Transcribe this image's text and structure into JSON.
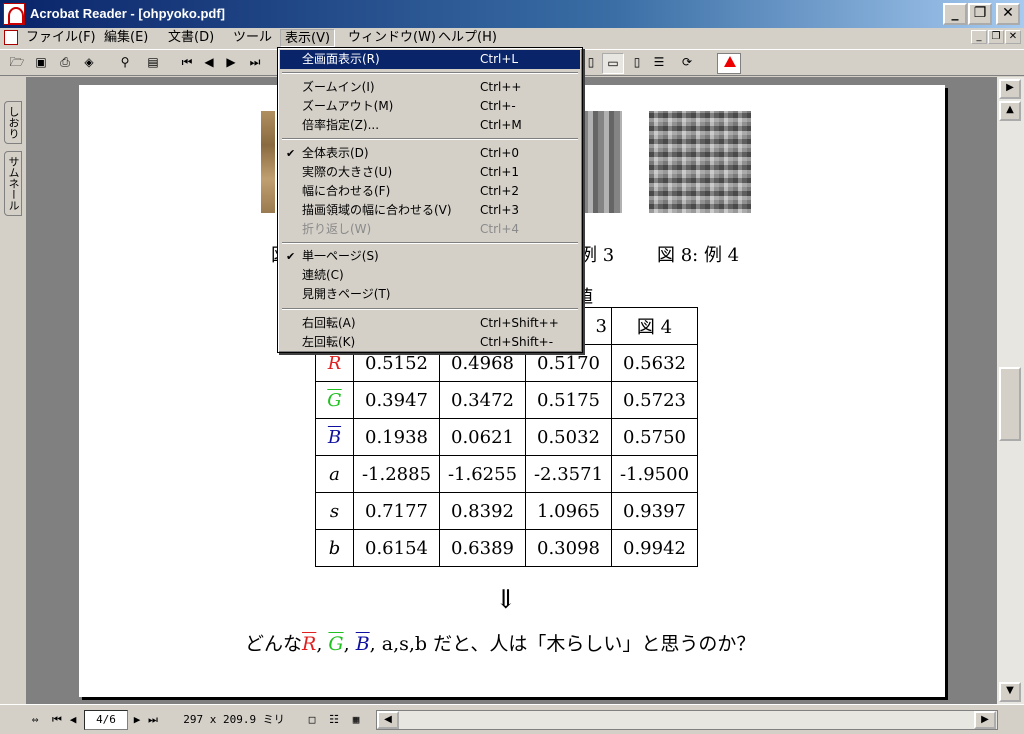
{
  "window": {
    "title": "Acrobat Reader - [ohpyoko.pdf]"
  },
  "menubar": {
    "items": [
      "ファイル(F)",
      "編集(E)",
      "文書(D)",
      "ツール",
      "表示(V)",
      "ウィンドウ(W)",
      "ヘルプ(H)"
    ]
  },
  "view_menu": {
    "items": [
      {
        "label": "全画面表示(R)",
        "accel": "Ctrl+L"
      },
      {
        "label": "ズームイン(I)",
        "accel": "Ctrl++"
      },
      {
        "label": "ズームアウト(M)",
        "accel": "Ctrl+-"
      },
      {
        "label": "倍率指定(Z)...",
        "accel": "Ctrl+M"
      },
      {
        "label": "全体表示(D)",
        "accel": "Ctrl+0"
      },
      {
        "label": "実際の大きさ(U)",
        "accel": "Ctrl+1"
      },
      {
        "label": "幅に合わせる(F)",
        "accel": "Ctrl+2"
      },
      {
        "label": "描画領域の幅に合わせる(V)",
        "accel": "Ctrl+3"
      },
      {
        "label": "折り返し(W)",
        "accel": "Ctrl+4"
      },
      {
        "label": "単一ページ(S)",
        "accel": ""
      },
      {
        "label": "連続(C)",
        "accel": ""
      },
      {
        "label": "見開きページ(T)",
        "accel": ""
      },
      {
        "label": "右回転(A)",
        "accel": "Ctrl+Shift++"
      },
      {
        "label": "左回転(K)",
        "accel": "Ctrl+Shift+-"
      }
    ],
    "check_mark": "✔"
  },
  "nav_tabs": [
    "しおり",
    "サムネール"
  ],
  "document": {
    "captions": [
      "図",
      "例 3",
      "図 8: 例 4"
    ],
    "table_title": "値",
    "table": {
      "header": [
        "3",
        "図 4"
      ],
      "rows": [
        {
          "label": "R",
          "values": [
            "0.5152",
            "0.4968",
            "0.5170",
            "0.5632"
          ]
        },
        {
          "label": "G",
          "values": [
            "0.3947",
            "0.3472",
            "0.5175",
            "0.5723"
          ]
        },
        {
          "label": "B",
          "values": [
            "0.1938",
            "0.0621",
            "0.5032",
            "0.5750"
          ]
        },
        {
          "label": "a",
          "values": [
            "-1.2885",
            "-1.6255",
            "-2.3571",
            "-1.9500"
          ]
        },
        {
          "label": "s",
          "values": [
            "0.7177",
            "0.8392",
            "1.0965",
            "0.9397"
          ]
        },
        {
          "label": "b",
          "values": [
            "0.6154",
            "0.6389",
            "0.3098",
            "0.9942"
          ]
        }
      ]
    },
    "arrow": "⇓",
    "question": {
      "prefix": "どんな",
      "r": "R",
      "g": "G",
      "b": "B",
      "sep": ", ",
      "suffix": ", a,s,b だと、人は「木らしい」と思うのか？"
    }
  },
  "colors": {
    "red": "#e02020",
    "green": "#20c020",
    "blue": "#1010a0"
  },
  "status": {
    "page": "4/6",
    "size": "297 x 209.9 ミリ"
  }
}
